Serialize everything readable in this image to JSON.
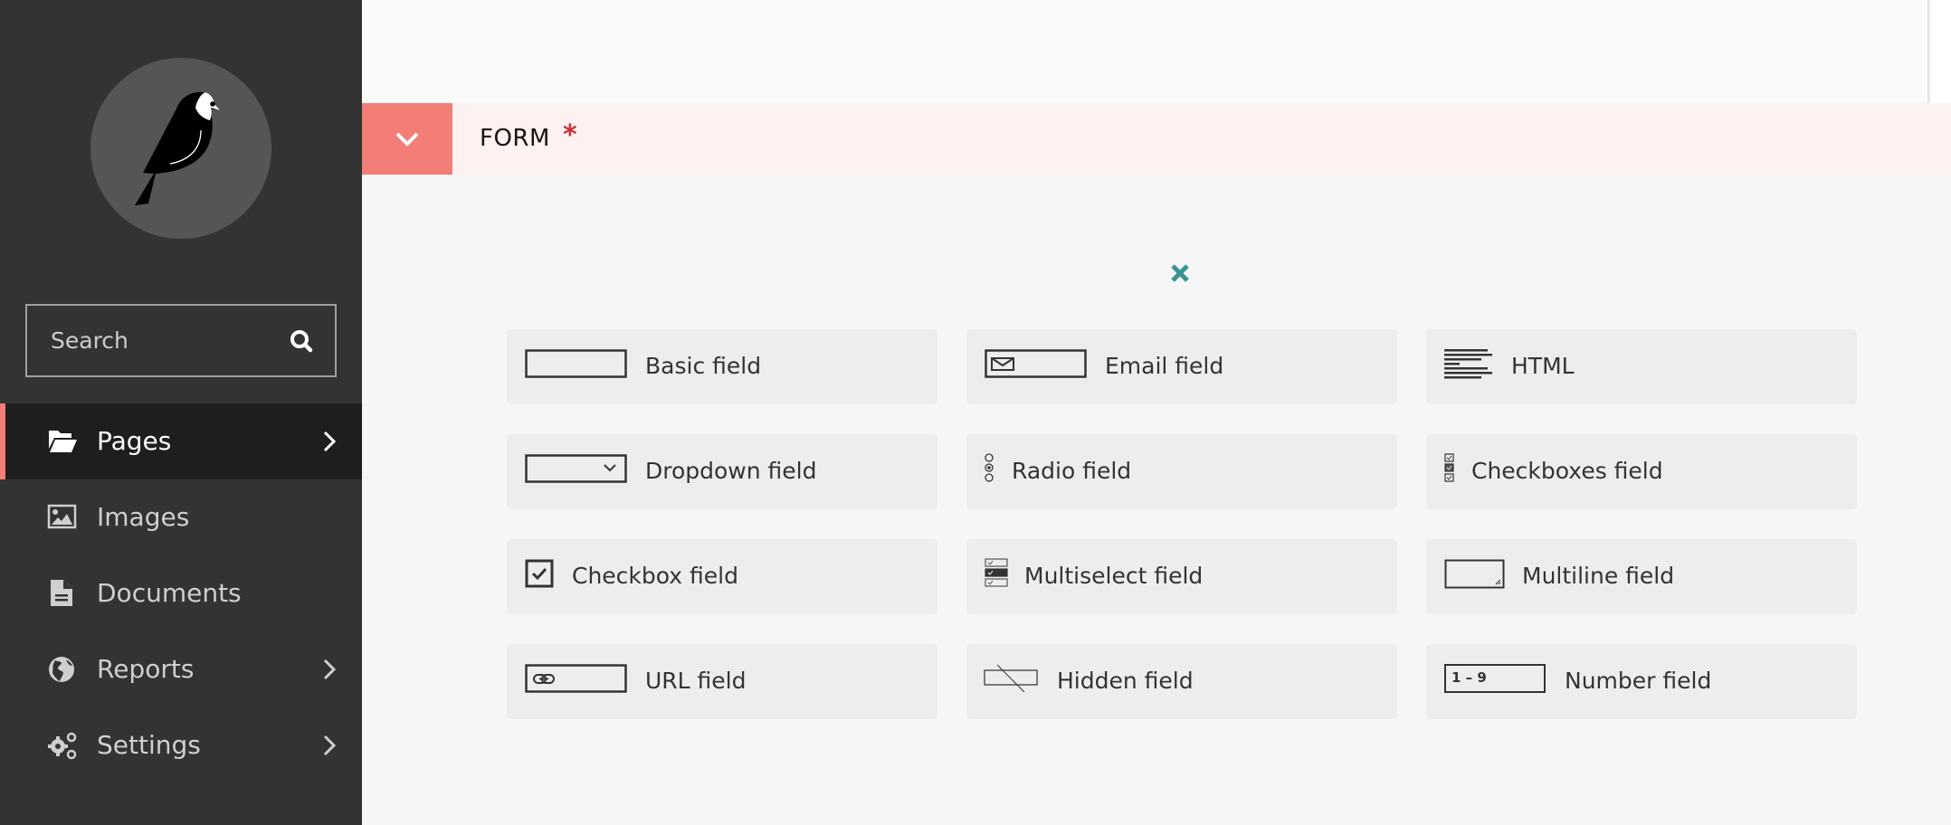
{
  "sidebar": {
    "logo_alt": "Wagtail bird logo",
    "search": {
      "placeholder": "Search",
      "value": ""
    },
    "items": [
      {
        "label": "Pages",
        "icon": "folder-open-icon",
        "active": true,
        "has_submenu": true
      },
      {
        "label": "Images",
        "icon": "image-icon",
        "active": false,
        "has_submenu": false
      },
      {
        "label": "Documents",
        "icon": "document-icon",
        "active": false,
        "has_submenu": false
      },
      {
        "label": "Reports",
        "icon": "globe-icon",
        "active": false,
        "has_submenu": true
      },
      {
        "label": "Settings",
        "icon": "cogs-icon",
        "active": false,
        "has_submenu": true
      }
    ]
  },
  "form_panel": {
    "title": "FORM",
    "required_marker": "*",
    "toggle_icon": "chevron-down-icon",
    "close_icon": "close-icon"
  },
  "field_types": [
    {
      "label": "Basic field",
      "icon": "basic-field-icon"
    },
    {
      "label": "Email field",
      "icon": "email-field-icon"
    },
    {
      "label": "HTML",
      "icon": "html-icon"
    },
    {
      "label": "Dropdown field",
      "icon": "dropdown-field-icon"
    },
    {
      "label": "Radio field",
      "icon": "radio-field-icon"
    },
    {
      "label": "Checkboxes field",
      "icon": "checkboxes-field-icon"
    },
    {
      "label": "Checkbox field",
      "icon": "checkbox-field-icon"
    },
    {
      "label": "Multiselect field",
      "icon": "multiselect-field-icon"
    },
    {
      "label": "Multiline field",
      "icon": "multiline-field-icon"
    },
    {
      "label": "URL field",
      "icon": "url-field-icon"
    },
    {
      "label": "Hidden field",
      "icon": "hidden-field-icon"
    },
    {
      "label": "Number field",
      "icon": "number-field-icon",
      "icon_text": "1 – 9"
    }
  ],
  "colors": {
    "sidebar_bg": "#333333",
    "accent": "#f37e77",
    "close_teal": "#3a9495",
    "required_red": "#cd3238"
  }
}
